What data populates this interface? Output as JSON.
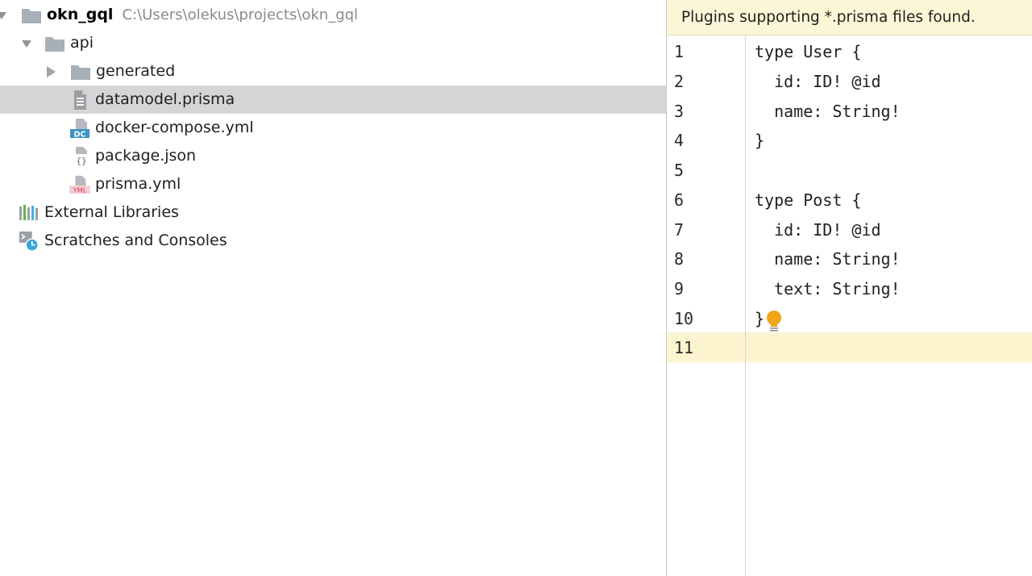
{
  "project_tree": {
    "root": {
      "name": "okn_gql",
      "path": "C:\\Users\\olekus\\projects\\okn_gql"
    },
    "items": [
      {
        "label": "api",
        "icon": "folder-icon",
        "expanded": true
      },
      {
        "label": "generated",
        "icon": "folder-icon",
        "expanded": false
      },
      {
        "label": "datamodel.prisma",
        "icon": "text-file-icon",
        "selected": true
      },
      {
        "label": "docker-compose.yml",
        "icon": "docker-compose-file-icon",
        "badge": "DC"
      },
      {
        "label": "package.json",
        "icon": "json-file-icon",
        "badge": "{}"
      },
      {
        "label": "prisma.yml",
        "icon": "yaml-file-icon",
        "badge": "YML"
      },
      {
        "label": "External Libraries",
        "icon": "libraries-icon"
      },
      {
        "label": "Scratches and Consoles",
        "icon": "scratches-icon"
      }
    ]
  },
  "editor": {
    "banner": "Plugins supporting *.prisma files found.",
    "lines": [
      {
        "number": "1",
        "text": "type User {"
      },
      {
        "number": "2",
        "text": "  id: ID! @id"
      },
      {
        "number": "3",
        "text": "  name: String!"
      },
      {
        "number": "4",
        "text": "}"
      },
      {
        "number": "5",
        "text": ""
      },
      {
        "number": "6",
        "text": "type Post {"
      },
      {
        "number": "7",
        "text": "  id: ID! @id"
      },
      {
        "number": "8",
        "text": "  name: String!"
      },
      {
        "number": "9",
        "text": "  text: String!"
      },
      {
        "number": "10",
        "text": "}"
      },
      {
        "number": "11",
        "text": ""
      }
    ],
    "current_line": "11"
  },
  "colors": {
    "selection": "#d5d5d5",
    "banner_bg": "#fcf6d6",
    "current_line_bg": "#fcf3cf",
    "folder": "#a7afb8",
    "bulb": "#f2a516",
    "dc_badge": "#3c93c7",
    "yml_badge": "#d33a52",
    "scratch_badge": "#3aa5dd"
  }
}
